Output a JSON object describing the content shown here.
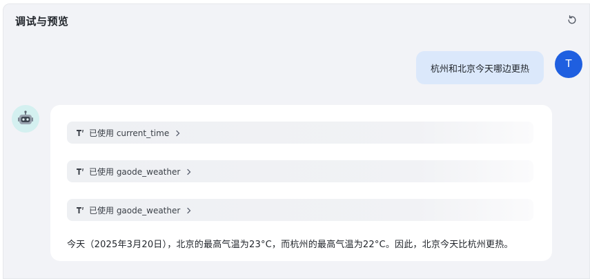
{
  "header": {
    "title": "调试与预览",
    "refresh_icon": "refresh-icon"
  },
  "user_message": {
    "text": "杭州和北京今天哪边更热",
    "avatar_letter": "T",
    "avatar_color": "#1f5fe0"
  },
  "bot_message": {
    "avatar_icon": "robot-icon",
    "tool_calls": [
      {
        "label": "已使用 current_time"
      },
      {
        "label": "已使用 gaode_weather"
      },
      {
        "label": "已使用 gaode_weather"
      }
    ],
    "answer": "今天（2025年3月20日），北京的最高气温为23°C，而杭州的最高气温为22°C。因此，北京今天比杭州更热。"
  },
  "colors": {
    "panel_bg": "#f2f3f7",
    "user_bubble": "#dbe8fb",
    "bot_avatar_bg": "#d4f0f0"
  }
}
